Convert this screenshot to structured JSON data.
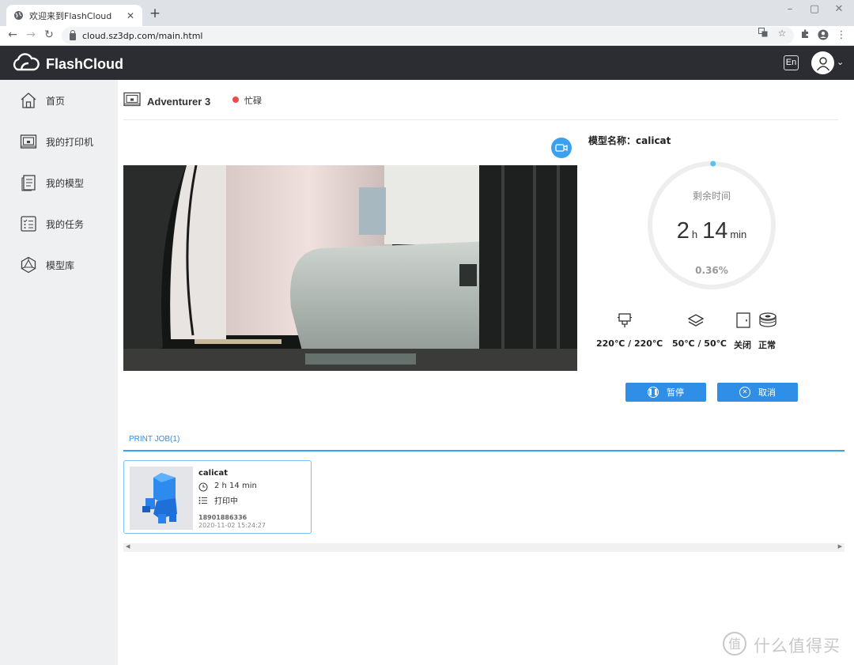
{
  "browser": {
    "tab_title": "欢迎来到FlashCloud",
    "url": "cloud.sz3dp.com/main.html"
  },
  "header": {
    "brand": "FlashCloud",
    "lang_button": "En"
  },
  "sidebar": {
    "items": [
      {
        "label": "首页",
        "icon": "home-icon"
      },
      {
        "label": "我的打印机",
        "icon": "printer-icon"
      },
      {
        "label": "我的模型",
        "icon": "document-icon"
      },
      {
        "label": "我的任务",
        "icon": "checklist-icon"
      },
      {
        "label": "模型库",
        "icon": "polyhedron-icon"
      }
    ]
  },
  "printer": {
    "name": "Adventurer 3",
    "status": "忙碌",
    "status_color": "#f04b4b"
  },
  "model": {
    "title": "模型名称：calicat"
  },
  "progress": {
    "label": "剩余时间",
    "hours": "2",
    "hours_unit": "h",
    "minutes": "14",
    "minutes_unit": "min",
    "percent_text": "0.36%",
    "fraction": 0.0036
  },
  "stats": {
    "nozzle_temp": "220℃ / 220℃",
    "bed_temp": "50℃ / 50℃",
    "door_status": "关闭",
    "filament_status": "正常"
  },
  "actions": {
    "pause": "暂停",
    "cancel": "取消"
  },
  "jobs": {
    "tab_label": "PRINT JOB(1)",
    "items": [
      {
        "name": "calicat",
        "time": "2 h 14 min",
        "status": "打印中",
        "phone": "18901886336",
        "date": "2020-11-02 15:24:27"
      }
    ]
  },
  "watermark": {
    "text": "什么值得买",
    "glyph": "值"
  },
  "colors": {
    "accent": "#2f8fe6",
    "header_bg": "#2b2d33",
    "sidebar_bg": "#eef0f2"
  }
}
